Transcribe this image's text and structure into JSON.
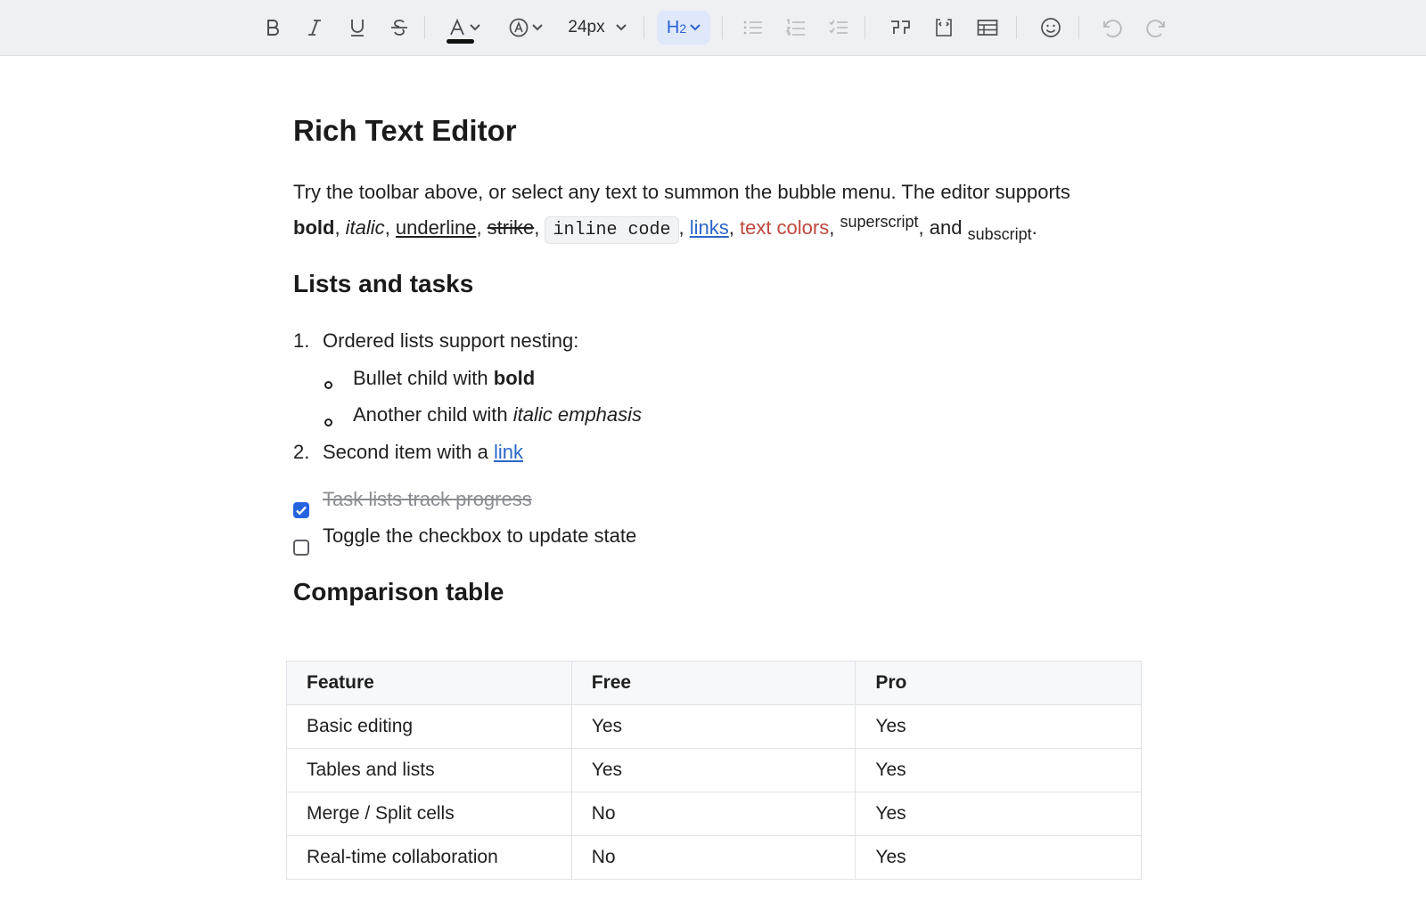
{
  "toolbar": {
    "buttons": [
      {
        "icon": "bold-icon"
      },
      {
        "icon": "italic-icon"
      },
      {
        "icon": "underline-icon"
      },
      {
        "icon": "strikethrough-icon"
      },
      {
        "icon": "text-color-icon",
        "current_color": "#111111"
      },
      {
        "icon": "highlight-icon"
      },
      {
        "icon": "heading-icon",
        "state": "active"
      },
      {
        "icon": "bullet-list-icon",
        "state": "disabled"
      },
      {
        "icon": "ordered-list-icon",
        "state": "disabled"
      },
      {
        "icon": "task-list-icon",
        "state": "disabled"
      },
      {
        "icon": "blockquote-icon"
      },
      {
        "icon": "code-block-icon"
      },
      {
        "icon": "table-icon"
      },
      {
        "icon": "emoji-icon"
      },
      {
        "icon": "undo-icon",
        "state": "disabled"
      },
      {
        "icon": "redo-icon",
        "state": "disabled"
      }
    ],
    "font_size": "24px",
    "heading_main": "H",
    "heading_level": "2"
  },
  "colors": {
    "accent": "#2563e0",
    "link": "#2a66c9",
    "red_text": "#c0473d",
    "toolbar_bg": "#eef0f3"
  },
  "doc": {
    "title": "Rich Text Editor",
    "intro_line1": "Try the toolbar above, or select any text to summon the bubble menu. The editor supports",
    "intro": {
      "bold": "bold",
      "italic": "italic",
      "underline": "underline",
      "strike": "strike",
      "code": "inline code",
      "links": "links",
      "text_colors": "text colors",
      "superscript": "superscript",
      "and": "and",
      "subscript": "subscript"
    },
    "lists_heading": "Lists and tasks",
    "ordered": [
      {
        "marker": "1.",
        "text": "Ordered lists support nesting:"
      },
      {
        "marker": "2.",
        "text": "Second item with a ",
        "link": "link"
      }
    ],
    "nested": [
      {
        "text": "Bullet child with ",
        "emph": "bold"
      },
      {
        "text": "Another child with ",
        "emph": "italic emphasis"
      }
    ],
    "tasks": [
      {
        "text": "Task lists track progress",
        "checked": true
      },
      {
        "text": "Toggle the checkbox to update state",
        "checked": false
      }
    ],
    "table_heading": "Comparison table",
    "table": {
      "headers": [
        "Feature",
        "Free",
        "Pro"
      ],
      "rows": [
        [
          "Basic editing",
          "Yes",
          "Yes"
        ],
        [
          "Tables and lists",
          "Yes",
          "Yes"
        ],
        [
          "Merge / Split cells",
          "No",
          "Yes"
        ],
        [
          "Real-time collaboration",
          "No",
          "Yes"
        ]
      ]
    }
  }
}
